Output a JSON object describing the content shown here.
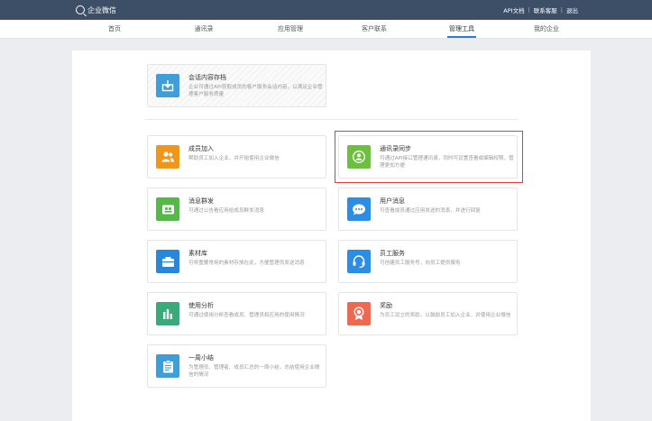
{
  "app": {
    "name": "企业微信"
  },
  "top_links": [
    "API文档",
    "联系客服",
    "退出"
  ],
  "nav": [
    {
      "label": "首页",
      "active": false
    },
    {
      "label": "通讯录",
      "active": false
    },
    {
      "label": "应用管理",
      "active": false
    },
    {
      "label": "客户联系",
      "active": false
    },
    {
      "label": "管理工具",
      "active": true
    },
    {
      "label": "我的企业",
      "active": false
    }
  ],
  "featured": {
    "title": "会话内容存档",
    "desc": "企业可通过API获取成员的客户服务会话内容，以满足企业管理客户服务质量",
    "color": "#3f9ed8",
    "icon": "download-box-icon"
  },
  "tools": [
    {
      "title": "成员加入",
      "desc": "帮助员工加入企业，并开始使用企业微信",
      "color": "#f0961a",
      "icon": "people-icon"
    },
    {
      "title": "通讯录同步",
      "desc": "可通过API接口管理通讯录，同时可设置查看或编辑权限，管理更加方便",
      "color": "#6cbf3f",
      "icon": "sync-person-icon"
    },
    {
      "title": "消息群发",
      "desc": "可通过公告看应用给成员群发消息",
      "color": "#55b94a",
      "icon": "broadcast-icon"
    },
    {
      "title": "用户消息",
      "desc": "可查看成员通过应用发送的消息，并进行回复",
      "color": "#2b8ee4",
      "icon": "chat-bubble-icon"
    },
    {
      "title": "素材库",
      "desc": "可将重要常用的素材存放在此，方便管理员发送消息",
      "color": "#2a86d9",
      "icon": "folder-icon"
    },
    {
      "title": "员工服务",
      "desc": "可创建员工服务号，向员工提供服务",
      "color": "#2b8ee4",
      "icon": "headset-icon"
    },
    {
      "title": "使用分析",
      "desc": "可通过使用分析查看成员、管理员和应用的使用情况",
      "color": "#3aaa7a",
      "icon": "bar-chart-icon"
    },
    {
      "title": "奖励",
      "desc": "为员工设立的奖励，以鼓励员工加入企业、并使用企业微信",
      "color": "#f0684f",
      "icon": "medal-icon"
    },
    {
      "title": "一周小结",
      "desc": "为管理员、管理者、成员汇总的一周小结，总结使用企业微信的情况",
      "color": "#3f9ed8",
      "icon": "clipboard-icon"
    }
  ],
  "highlight_color": "#e03c3c"
}
